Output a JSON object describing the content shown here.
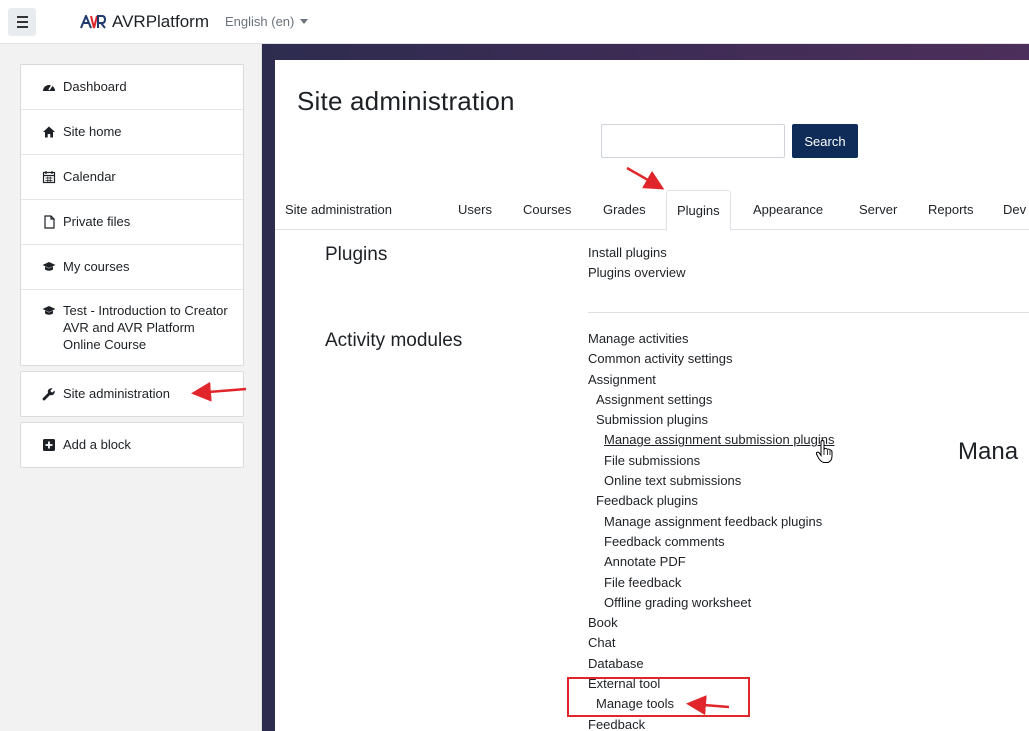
{
  "navbar": {
    "brand_name": "AVRPlatform",
    "language": "English (en)"
  },
  "drawer": {
    "items": [
      {
        "label": "Dashboard",
        "icon": "dashboard-icon"
      },
      {
        "label": "Site home",
        "icon": "home-icon"
      },
      {
        "label": "Calendar",
        "icon": "calendar-icon"
      },
      {
        "label": "Private files",
        "icon": "file-icon"
      },
      {
        "label": "My courses",
        "icon": "graduation-cap-icon"
      },
      {
        "label": "Test - Introduction to Creator AVR and AVR Platform Online Course",
        "icon": "graduation-cap-icon"
      }
    ],
    "admin_label": "Site administration",
    "add_block_label": "Add a block"
  },
  "page": {
    "title": "Site administration",
    "search_button": "Search",
    "search_value": "",
    "tabs": [
      "Site administration",
      "Users",
      "Courses",
      "Grades",
      "Plugins",
      "Appearance",
      "Server",
      "Reports",
      "Dev"
    ],
    "active_tab": "Plugins",
    "sections": [
      {
        "label": "Plugins",
        "links": [
          "Install plugins",
          "Plugins overview"
        ]
      },
      {
        "label": "Activity modules",
        "links": [
          "Manage activities",
          "Common activity settings",
          "Assignment",
          "Assignment settings",
          "Submission plugins",
          "Manage assignment submission plugins",
          "File submissions",
          "Online text submissions",
          "Feedback plugins",
          "Manage assignment feedback plugins",
          "Feedback comments",
          "Annotate PDF",
          "File feedback",
          "Offline grading worksheet",
          "Book",
          "Chat",
          "Database",
          "External tool",
          "Manage tools",
          "Feedback"
        ]
      }
    ],
    "truncated_heading": "Mana"
  },
  "colors": {
    "search_button_bg": "#0f2b58",
    "annotation_red": "#e0262a"
  }
}
